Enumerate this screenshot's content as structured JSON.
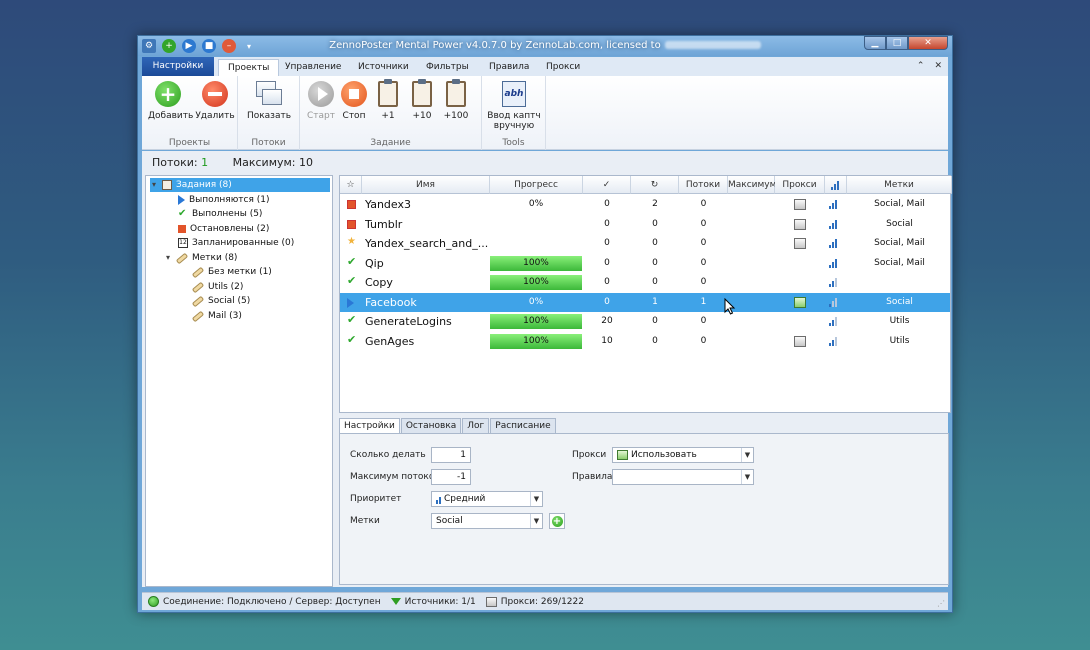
{
  "window": {
    "title": "ZennoPoster Mental Power v4.0.7.0 by ZennoLab.com, licensed to"
  },
  "ribbon_tabs": {
    "app": "Настройки",
    "tabs": [
      "Проекты",
      "Управление",
      "Источники",
      "Фильтры",
      "Правила",
      "Прокси"
    ]
  },
  "ribbon": {
    "projects": {
      "label": "Проекты",
      "add": "Добавить",
      "delete": "Удалить"
    },
    "threads": {
      "label": "Потоки",
      "show": "Показать"
    },
    "task": {
      "label": "Задание",
      "start": "Старт",
      "stop": "Стоп",
      "plus1": "+1",
      "plus10": "+10",
      "plus100": "+100"
    },
    "tools": {
      "label": "Tools",
      "captcha_line1": "Ввод каптч",
      "captcha_line2": "вручную",
      "captcha_icon_text": "abh"
    }
  },
  "counters": {
    "threads_label": "Потоки:",
    "threads_value": "1",
    "max_label": "Максимум:",
    "max_value": "10"
  },
  "tree": {
    "root": "Задания (8)",
    "running": "Выполняются (1)",
    "done": "Выполнены (5)",
    "stopped": "Остановлены (2)",
    "scheduled": "Запланированные (0)",
    "scheduled_icon": "12",
    "tags": "Метки (8)",
    "no_tag": "Без метки (1)",
    "utils": "Utils (2)",
    "social": "Social (5)",
    "mail": "Mail (3)"
  },
  "grid": {
    "columns": [
      "Имя",
      "Прогресс",
      "✓",
      "↻",
      "Потоки",
      "Максимум",
      "Прокси",
      "Метки"
    ],
    "rows": [
      {
        "status": "stopped",
        "name": "Yandex3",
        "progress_text": "0%",
        "progress": 0,
        "done": "0",
        "repeat": "2",
        "threads": "0",
        "max": "",
        "proxy": "gray",
        "signal": 3,
        "tags": "Social, Mail"
      },
      {
        "status": "stopped",
        "name": "Tumblr",
        "progress_text": "",
        "progress": 0,
        "done": "0",
        "repeat": "0",
        "threads": "0",
        "max": "",
        "proxy": "gray",
        "signal": 3,
        "tags": "Social"
      },
      {
        "status": "star",
        "name": "Yandex_search_and_...",
        "progress_text": "",
        "progress": 0,
        "done": "0",
        "repeat": "0",
        "threads": "0",
        "max": "",
        "proxy": "gray",
        "signal": 3,
        "tags": "Social, Mail"
      },
      {
        "status": "done",
        "name": "Qip",
        "progress_text": "100%",
        "progress": 100,
        "done": "0",
        "repeat": "0",
        "threads": "0",
        "max": "",
        "proxy": "none",
        "signal": 3,
        "tags": "Social, Mail"
      },
      {
        "status": "done",
        "name": "Copy",
        "progress_text": "100%",
        "progress": 100,
        "done": "0",
        "repeat": "0",
        "threads": "0",
        "max": "",
        "proxy": "none",
        "signal": 2,
        "tags": ""
      },
      {
        "status": "running",
        "name": "Facebook",
        "progress_text": "0%",
        "progress": 0,
        "done": "0",
        "repeat": "1",
        "threads": "1",
        "max": "",
        "proxy": "green",
        "signal": 1,
        "tags": "Social"
      },
      {
        "status": "done",
        "name": "GenerateLogins",
        "progress_text": "100%",
        "progress": 100,
        "done": "20",
        "repeat": "0",
        "threads": "0",
        "max": "",
        "proxy": "none",
        "signal": 2,
        "tags": "Utils"
      },
      {
        "status": "done",
        "name": "GenAges",
        "progress_text": "100%",
        "progress": 100,
        "done": "10",
        "repeat": "0",
        "threads": "0",
        "max": "",
        "proxy": "gray",
        "signal": 2,
        "tags": "Utils"
      }
    ]
  },
  "bottom_tabs": [
    "Настройки",
    "Остановка",
    "Лог",
    "Расписание"
  ],
  "settings": {
    "count_label": "Сколько делать",
    "count_value": "1",
    "max_threads_label": "Максимум потоков",
    "max_threads_value": "-1",
    "priority_label": "Приоритет",
    "priority_value": "Средний",
    "tags_label": "Метки",
    "tags_value": "Social",
    "proxy_label": "Прокси",
    "proxy_value": "Использовать",
    "rules_label": "Правила",
    "rules_value": ""
  },
  "statusbar": {
    "connection": "Соединение: Подключено / Сервер: Доступен",
    "sources": "Источники: 1/1",
    "proxies": "Прокси: 269/1222"
  },
  "colors": {
    "selection": "#3fa3e8",
    "progress_fill": "#3cb83a",
    "app_tab": "#1b4a98"
  }
}
